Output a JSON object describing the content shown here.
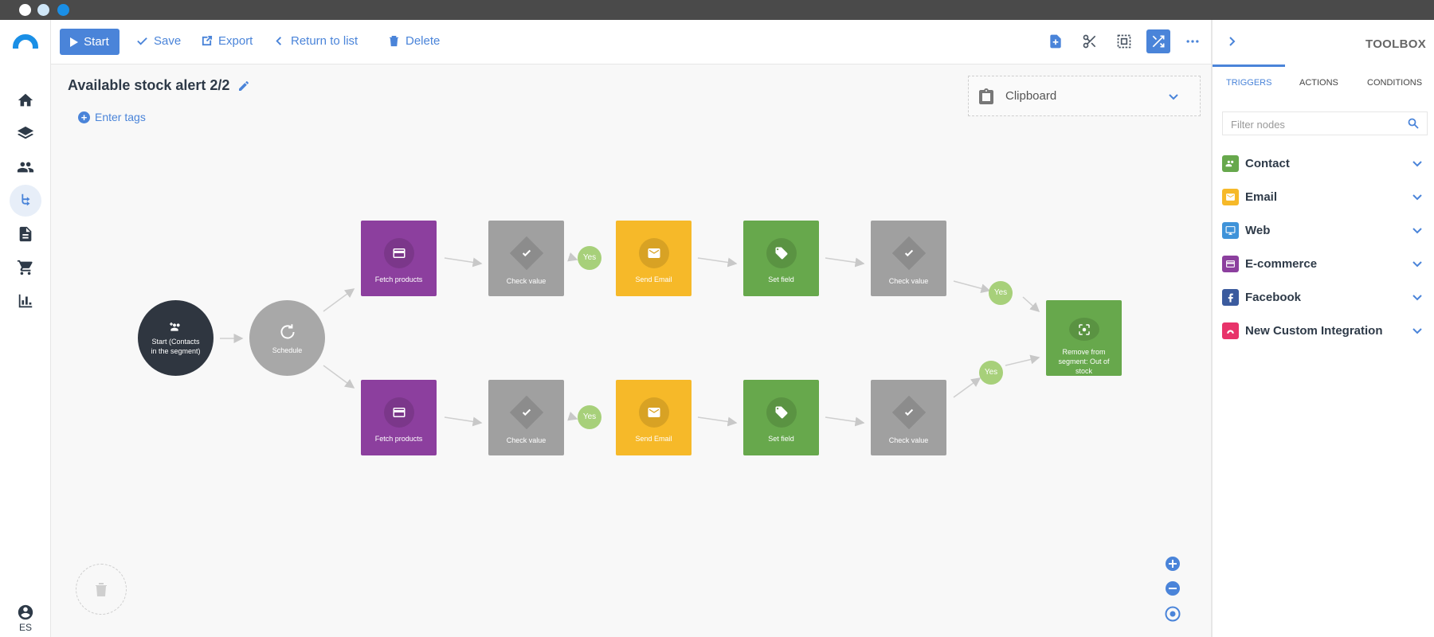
{
  "toolbar": {
    "start_label": "Start",
    "save_label": "Save",
    "export_label": "Export",
    "return_label": "Return to list",
    "delete_label": "Delete"
  },
  "workflow": {
    "title": "Available stock alert 2/2",
    "tags_label": "Enter tags"
  },
  "clipboard": {
    "label": "Clipboard"
  },
  "nodes": {
    "start": "Start (Contacts in the segment)",
    "schedule": "Schedule",
    "fetch_products": "Fetch products",
    "check_value": "Check value",
    "send_email": "Send Email",
    "set_field": "Set field",
    "remove": "Remove from segment: Out of stock",
    "yes": "Yes"
  },
  "nav": {
    "language": "ES"
  },
  "toolbox": {
    "title": "TOOLBOX",
    "tabs": [
      "TRIGGERS",
      "ACTIONS",
      "CONDITIONS"
    ],
    "filter_placeholder": "Filter nodes",
    "categories": [
      {
        "label": "Contact",
        "color": "#67a84c"
      },
      {
        "label": "Email",
        "color": "#f6b929"
      },
      {
        "label": "Web",
        "color": "#3f93d9"
      },
      {
        "label": "E-commerce",
        "color": "#8c3f9e"
      },
      {
        "label": "Facebook",
        "color": "#3b5b9e"
      },
      {
        "label": "New Custom Integration",
        "color": "#e8336a"
      }
    ]
  },
  "colors": {
    "accent": "#4a84d9",
    "purple": "#8c3f9e",
    "gray": "#a0a0a0",
    "yellow": "#f6b929",
    "green": "#67a84c",
    "dark": "#2f3640",
    "yes": "#a7d07a"
  }
}
